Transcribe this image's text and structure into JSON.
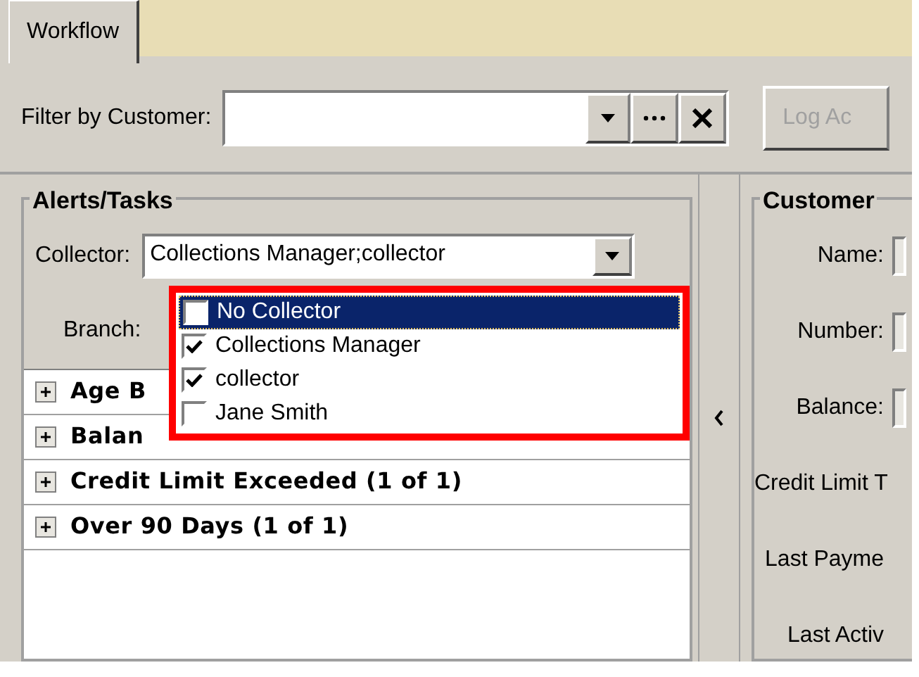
{
  "tabs": [
    {
      "label": "Workflow",
      "selected": true
    }
  ],
  "filter": {
    "label": "Filter by Customer:"
  },
  "log_button": {
    "label": "Log Ac",
    "disabled": true
  },
  "alerts": {
    "title": "Alerts/Tasks",
    "collector": {
      "label": "Collector:",
      "value": "Collections Manager;collector"
    },
    "branch": {
      "label": "Branch:"
    },
    "groups": [
      {
        "label": "Age B",
        "expanded": false
      },
      {
        "label": "Balan",
        "expanded": false
      },
      {
        "label": "Credit Limit Exceeded (1 of 1)",
        "expanded": false
      },
      {
        "label": "Over 90 Days (1 of 1)",
        "expanded": false
      }
    ]
  },
  "collector_dropdown": {
    "items": [
      {
        "label": "No Collector",
        "checked": false,
        "selected": true
      },
      {
        "label": "Collections Manager",
        "checked": true,
        "selected": false
      },
      {
        "label": "collector",
        "checked": true,
        "selected": false
      },
      {
        "label": "Jane Smith",
        "checked": false,
        "selected": false
      }
    ]
  },
  "customer": {
    "title": "Customer",
    "fields": [
      {
        "label": "Name:"
      },
      {
        "label": "Number:"
      },
      {
        "label": "Balance:"
      },
      {
        "label": "Credit Limit T"
      },
      {
        "label": "Last Payme"
      },
      {
        "label": "Last Activ"
      }
    ]
  }
}
